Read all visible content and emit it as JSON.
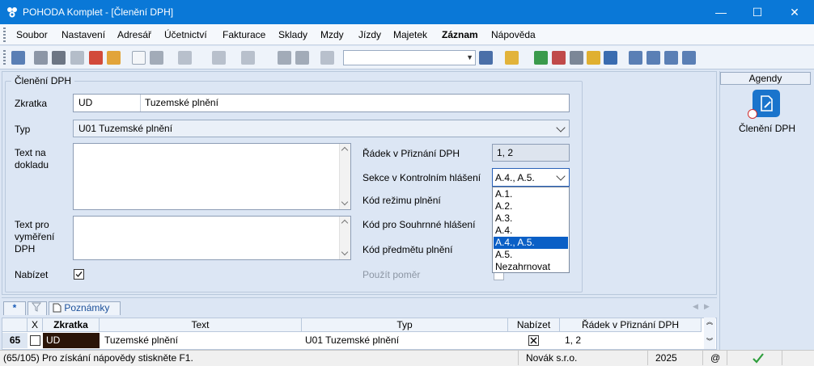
{
  "window": {
    "title": "POHODA Komplet - [Členění DPH]",
    "minimize": "—",
    "maximize": "☐",
    "close": "✕"
  },
  "menu": {
    "items": [
      "Soubor",
      "Nastavení",
      "Adresář",
      "Účetnictví",
      "Fakturace",
      "Sklady",
      "Mzdy",
      "Jízdy",
      "Majetek",
      "Záznam",
      "Nápověda"
    ]
  },
  "form": {
    "group_title": "Členění DPH",
    "zkratka_label": "Zkratka",
    "zkratka_value": "UD",
    "nazev_value": "Tuzemské plnění",
    "typ_label": "Typ",
    "typ_value": "U01 Tuzemské plnění",
    "text_dokladu_label_1": "Text na",
    "text_dokladu_label_2": "dokladu",
    "text_vymereni_label_1": "Text pro",
    "text_vymereni_label_2": "vyměření",
    "text_vymereni_label_3": "DPH",
    "nabizet_label": "Nabízet",
    "radek_label": "Řádek v Přiznání DPH",
    "radek_value": "1, 2",
    "sekce_label": "Sekce v Kontrolním hlášení",
    "sekce_value": "A.4., A.5.",
    "kod_rezimu_label": "Kód režimu plnění",
    "kod_souhrnne_label": "Kód pro Souhrnné hlášení",
    "kod_predmetu_label": "Kód předmětu plnění",
    "pouzit_pomer_label": "Použít poměr"
  },
  "dropdown": {
    "options": [
      "A.1.",
      "A.2.",
      "A.3.",
      "A.4.",
      "A.4., A.5.",
      "A.5.",
      "Nezahrnovat"
    ],
    "selected_index": 4
  },
  "agenda": {
    "header": "Agendy",
    "item_label": "Členění DPH"
  },
  "tabs": {
    "star": "*",
    "poznamky": "Poznámky"
  },
  "grid": {
    "columns": [
      "X",
      "Zkratka",
      "Text",
      "Typ",
      "Nabízet",
      "Řádek v Přiznání DPH"
    ],
    "row_number": "65",
    "row": {
      "zkratka": "UD",
      "text": "Tuzemské plnění",
      "typ": "U01 Tuzemské plnění",
      "radek": "1, 2"
    }
  },
  "status": {
    "hint": "(65/105) Pro získání nápovědy stiskněte F1.",
    "company": "Novák s.r.o.",
    "year": "2025",
    "at": "@"
  },
  "colors": {
    "titlebar": "#0a78d7",
    "selection": "#0a5fc6",
    "zkratka_cell_bg": "#2b1508",
    "check_green": "#2e9e3c"
  }
}
